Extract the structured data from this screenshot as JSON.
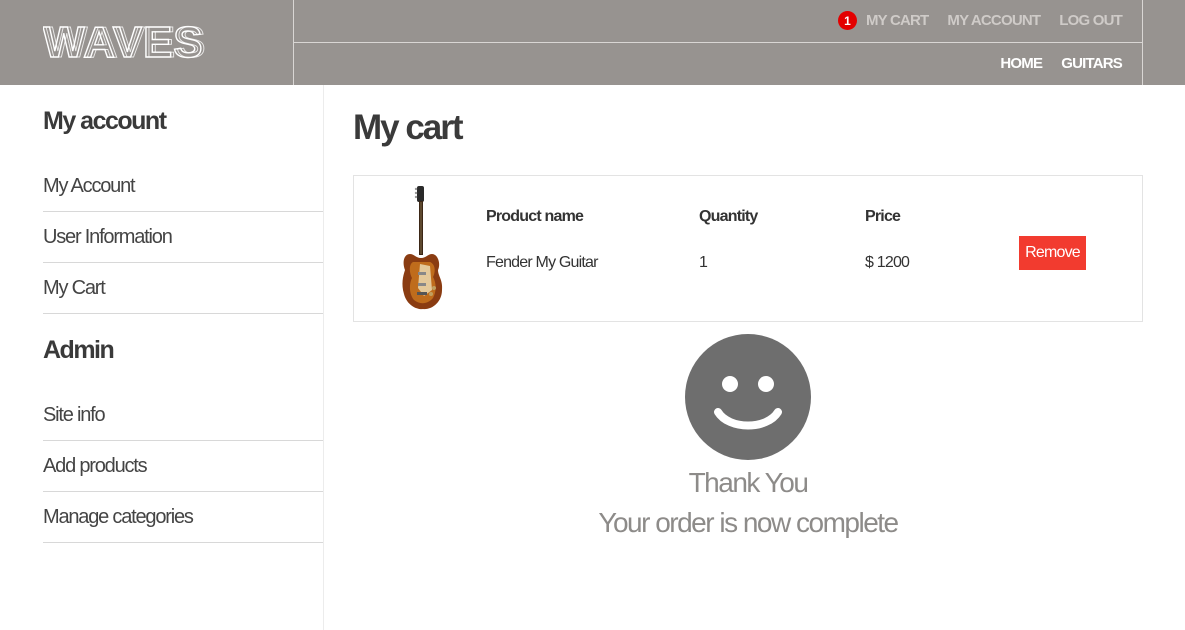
{
  "header": {
    "logo_text": "WAVES",
    "cart_count": "1",
    "top_links": [
      "My Cart",
      "My Account",
      "Log out"
    ],
    "nav_links": [
      "Home",
      "Guitars"
    ]
  },
  "sidebar": {
    "account_heading": "My account",
    "account_items": [
      "My Account",
      "User Information",
      "My Cart"
    ],
    "admin_heading": "Admin",
    "admin_items": [
      "Site info",
      "Add products",
      "Manage categories"
    ]
  },
  "main": {
    "title": "My cart",
    "table": {
      "headers": [
        "Product name",
        "Quantity",
        "Price"
      ],
      "rows": [
        {
          "product": "Fender My Guitar",
          "quantity": "1",
          "price": "$ 1200",
          "remove_label": "Remove"
        }
      ]
    },
    "success": {
      "line1": "Thank You",
      "line2": "Your order is now complete"
    }
  },
  "colors": {
    "header_bg": "#979390",
    "badge": "#e30000",
    "remove_button": "#f23b2f",
    "smiley": "#6e6e6e"
  },
  "icons": {
    "cart_badge": "badge",
    "product_image": "electric-guitar",
    "success_icon": "smiley-icon"
  }
}
